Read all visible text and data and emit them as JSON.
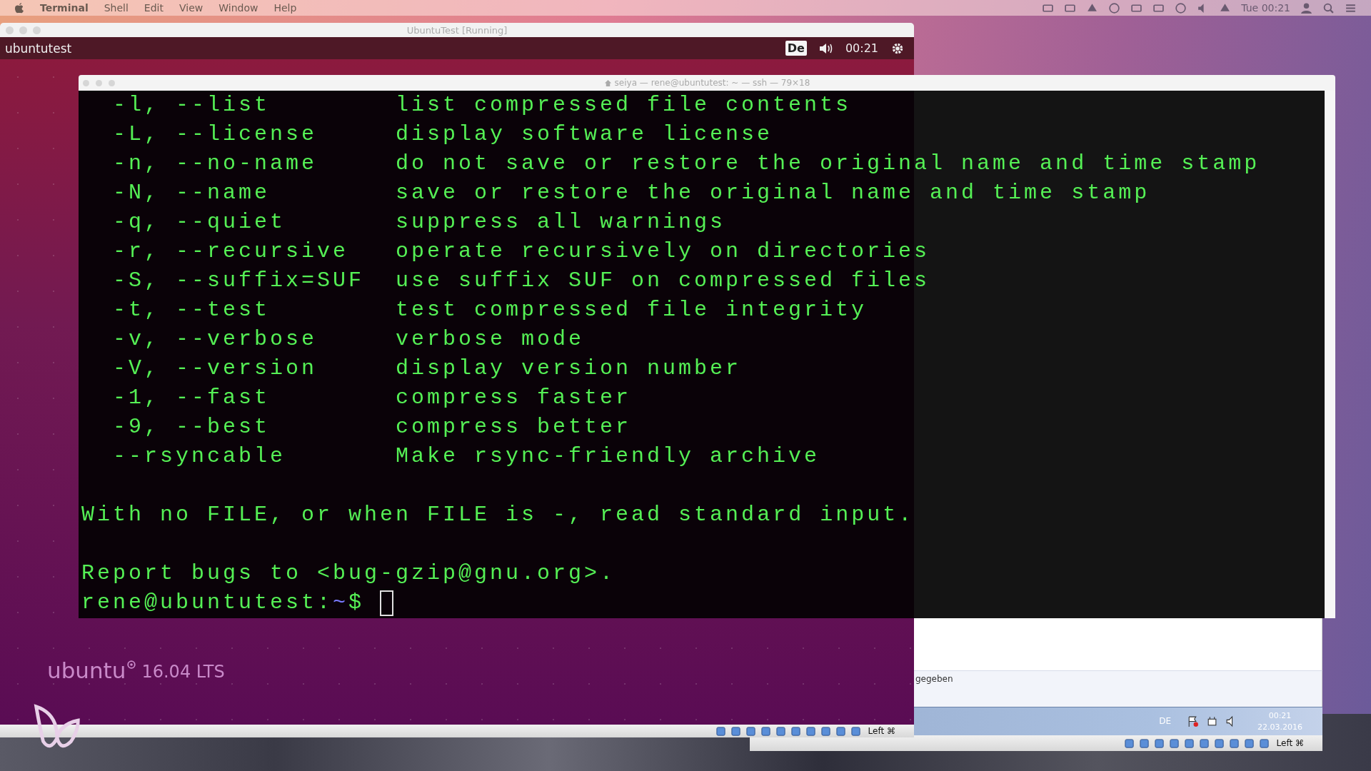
{
  "menubar": {
    "app": "Terminal",
    "menus": [
      "Shell",
      "Edit",
      "View",
      "Window",
      "Help"
    ],
    "clock": "Tue 00:21"
  },
  "vm_window": {
    "title": "UbuntuTest [Running]",
    "hostname": "ubuntutest",
    "keyboard": "De",
    "clock": "00:21",
    "brand": "ubuntu",
    "version": "16.04 LTS",
    "host_key": "Left ⌘"
  },
  "terminal": {
    "title": "seiya — rene@ubuntutest: ~ — ssh — 79×18",
    "options": [
      {
        "flag": "-l, --list",
        "description": "list compressed file contents"
      },
      {
        "flag": "-L, --license",
        "description": "display software license"
      },
      {
        "flag": "-n, --no-name",
        "description": "do not save or restore the original name and time stamp"
      },
      {
        "flag": "-N, --name",
        "description": "save or restore the original name and time stamp"
      },
      {
        "flag": "-q, --quiet",
        "description": "suppress all warnings"
      },
      {
        "flag": "-r, --recursive",
        "description": "operate recursively on directories"
      },
      {
        "flag": "-S, --suffix=SUF",
        "description": "use suffix SUF on compressed files"
      },
      {
        "flag": "-t, --test",
        "description": "test compressed file integrity"
      },
      {
        "flag": "-v, --verbose",
        "description": "verbose mode"
      },
      {
        "flag": "-V, --version",
        "description": "display version number"
      },
      {
        "flag": "-1, --fast",
        "description": "compress faster"
      },
      {
        "flag": "-9, --best",
        "description": "compress better"
      },
      {
        "flag": "--rsyncable",
        "description": "Make rsync-friendly archive"
      }
    ],
    "notes": [
      "With no FILE, or when FILE is -, read standard input.",
      "Report bugs to <bug-gzip@gnu.org>."
    ],
    "prompt": {
      "user_host": "rene@ubuntutest:",
      "path": "~",
      "symbol": "$"
    }
  },
  "windows_vm": {
    "text": "gegeben",
    "language": "DE",
    "time": "00:21",
    "date": "22.03.2016",
    "host_key": "Left ⌘"
  }
}
